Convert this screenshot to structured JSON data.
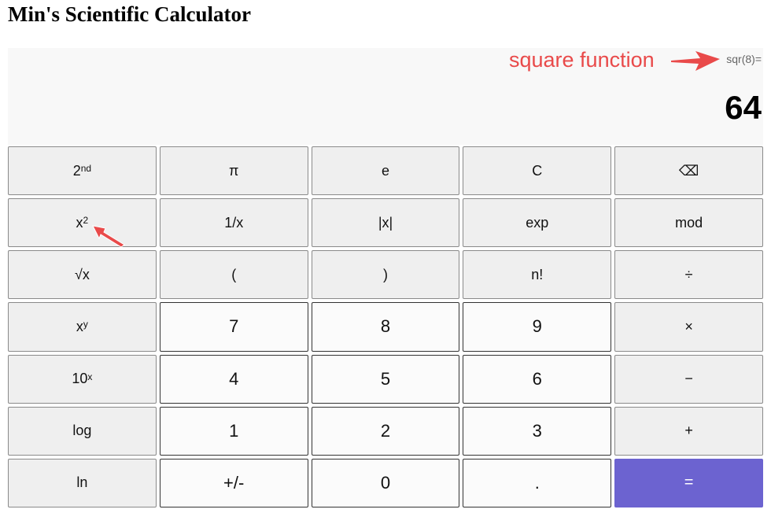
{
  "app": {
    "title": "Min's Scientific Calculator"
  },
  "display": {
    "expression": "sqr(8)=",
    "result": "64"
  },
  "annotation": {
    "label": "square function",
    "color": "#e94a4a"
  },
  "keys": [
    {
      "name": "second-function-button",
      "base": "2",
      "sup": "nd",
      "kind": "fn"
    },
    {
      "name": "pi-button",
      "base": "π",
      "kind": "fn"
    },
    {
      "name": "euler-button",
      "base": "e",
      "kind": "fn"
    },
    {
      "name": "clear-button",
      "base": "C",
      "kind": "fn"
    },
    {
      "name": "backspace-button",
      "base": "⌫",
      "kind": "fn"
    },
    {
      "name": "square-button",
      "base": "x",
      "sup": "2",
      "kind": "fn"
    },
    {
      "name": "reciprocal-button",
      "base": "1/x",
      "kind": "fn"
    },
    {
      "name": "absolute-button",
      "base": "|x|",
      "kind": "fn"
    },
    {
      "name": "exp-button",
      "base": "exp",
      "kind": "fn"
    },
    {
      "name": "mod-button",
      "base": "mod",
      "kind": "fn"
    },
    {
      "name": "sqrt-button",
      "base": "√x",
      "kind": "fn"
    },
    {
      "name": "open-paren-button",
      "base": "(",
      "kind": "fn"
    },
    {
      "name": "close-paren-button",
      "base": ")",
      "kind": "fn"
    },
    {
      "name": "factorial-button",
      "base": "n!",
      "kind": "fn"
    },
    {
      "name": "divide-button",
      "base": "÷",
      "kind": "fn"
    },
    {
      "name": "power-button",
      "base": "x",
      "sup": "y",
      "kind": "fn"
    },
    {
      "name": "digit-7-button",
      "base": "7",
      "kind": "num"
    },
    {
      "name": "digit-8-button",
      "base": "8",
      "kind": "num"
    },
    {
      "name": "digit-9-button",
      "base": "9",
      "kind": "num"
    },
    {
      "name": "multiply-button",
      "base": "×",
      "kind": "fn"
    },
    {
      "name": "ten-power-button",
      "base": "10",
      "sup": "x",
      "kind": "fn"
    },
    {
      "name": "digit-4-button",
      "base": "4",
      "kind": "num"
    },
    {
      "name": "digit-5-button",
      "base": "5",
      "kind": "num"
    },
    {
      "name": "digit-6-button",
      "base": "6",
      "kind": "num"
    },
    {
      "name": "subtract-button",
      "base": "−",
      "kind": "fn"
    },
    {
      "name": "log-button",
      "base": "log",
      "kind": "fn"
    },
    {
      "name": "digit-1-button",
      "base": "1",
      "kind": "num"
    },
    {
      "name": "digit-2-button",
      "base": "2",
      "kind": "num"
    },
    {
      "name": "digit-3-button",
      "base": "3",
      "kind": "num"
    },
    {
      "name": "add-button",
      "base": "+",
      "kind": "fn"
    },
    {
      "name": "ln-button",
      "base": "ln",
      "kind": "fn"
    },
    {
      "name": "negate-button",
      "base": "+/-",
      "kind": "num"
    },
    {
      "name": "digit-0-button",
      "base": "0",
      "kind": "num"
    },
    {
      "name": "decimal-button",
      "base": ".",
      "kind": "num"
    },
    {
      "name": "equals-button",
      "base": "=",
      "kind": "eq"
    }
  ]
}
